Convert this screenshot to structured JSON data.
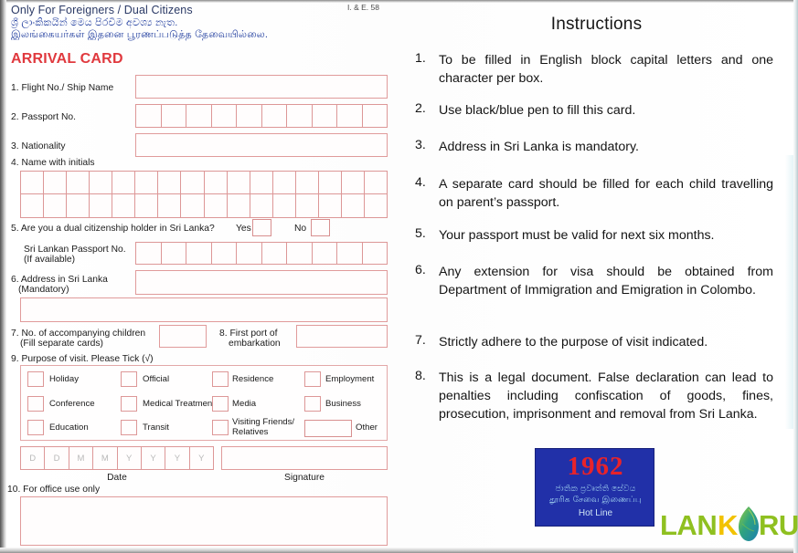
{
  "document": {
    "form_code": "I. & E. 58",
    "header_en": "Only For Foreigners / Dual Citizens",
    "header_si": "ශ්‍රී ලාංකිකයින් මෙය පිරවීම අවශ්‍ය නැත.",
    "header_ta": "இலங்கையர்கள்  இதனை  பூரணப்படுத்த  தேவையில்லை.",
    "card_title": "ARRIVAL CARD"
  },
  "fields": {
    "f1": {
      "label": "1. Flight No./ Ship Name"
    },
    "f2": {
      "label": "2. Passport No.",
      "boxes": 10
    },
    "f3": {
      "label": "3. Nationality"
    },
    "f4": {
      "label": "4. Name with initials",
      "boxes_per_row": 16,
      "rows": 2
    },
    "f5": {
      "label": "5. Are you a dual citizenship holder in Sri Lanka?",
      "yes_label": "Yes",
      "no_label": "No",
      "sub_label_line1": "Sri Lankan Passport No.",
      "sub_label_line2": "(If available)",
      "sub_boxes": 10
    },
    "f6": {
      "label_line1": "6. Address in Sri Lanka",
      "label_line2": "(Mandatory)"
    },
    "f7": {
      "label_line1": "7. No. of accompanying children",
      "label_line2": "(Fill separate cards)"
    },
    "f8": {
      "label_line1": "8. First port of",
      "label_line2": "embarkation"
    },
    "f9": {
      "label": "9. Purpose of visit. Please Tick (√)",
      "options": [
        "Holiday",
        "Official",
        "Residence",
        "Employment",
        "Conference",
        "Medical Treatment",
        "Media",
        "Business",
        "Education",
        "Transit",
        "Visiting Friends/\nRelatives",
        "Other"
      ]
    },
    "f10": {
      "label": "10. For office use only"
    },
    "date": {
      "caption": "Date",
      "boxes": [
        "D",
        "D",
        "M",
        "M",
        "Y",
        "Y",
        "Y",
        "Y"
      ]
    },
    "signature": {
      "caption": "Signature"
    }
  },
  "instructions": {
    "title": "Instructions",
    "items": [
      {
        "num": "1.",
        "text": "To be filled in English block capital letters and one character per box."
      },
      {
        "num": "2.",
        "text": "Use black/blue pen to fill this card."
      },
      {
        "num": "3.",
        "text": "Address in Sri Lanka is mandatory."
      },
      {
        "num": "4.",
        "text": "A separate card should be filled for each child travelling on parent’s passport."
      },
      {
        "num": "5.",
        "text": "Your passport must be valid for next six months."
      },
      {
        "num": "6.",
        "text": "Any extension for visa should be obtained from Department of Immigration and Emigration in Colombo."
      },
      {
        "num": "7.",
        "text": "Strictly adhere to the purpose of visit indicated."
      },
      {
        "num": "8.",
        "text": "This is a legal document. False declaration can lead to penalties including confiscation of goods, fines, prosecution, imprisonment and removal from Sri Lanka."
      }
    ]
  },
  "hotline": {
    "year": "1962",
    "line_si": "ජාතික ප්‍රවෘත්ති සේවය",
    "line_ta": "தூரிக  சேவை  இணைப்பு",
    "line_en": "Hot Line"
  },
  "logo": {
    "part1": "LAN",
    "part2": "K",
    "part3": "RUS",
    "full": "LANKARUS"
  },
  "colors": {
    "accent_red": "#e0393e",
    "box_border": "#dd9797",
    "header_blue": "#2440a0",
    "hotline_bg": "#2130a8",
    "hotline_year": "#e8232a",
    "logo_green": "#8fc020",
    "logo_yellow": "#f2c200"
  }
}
